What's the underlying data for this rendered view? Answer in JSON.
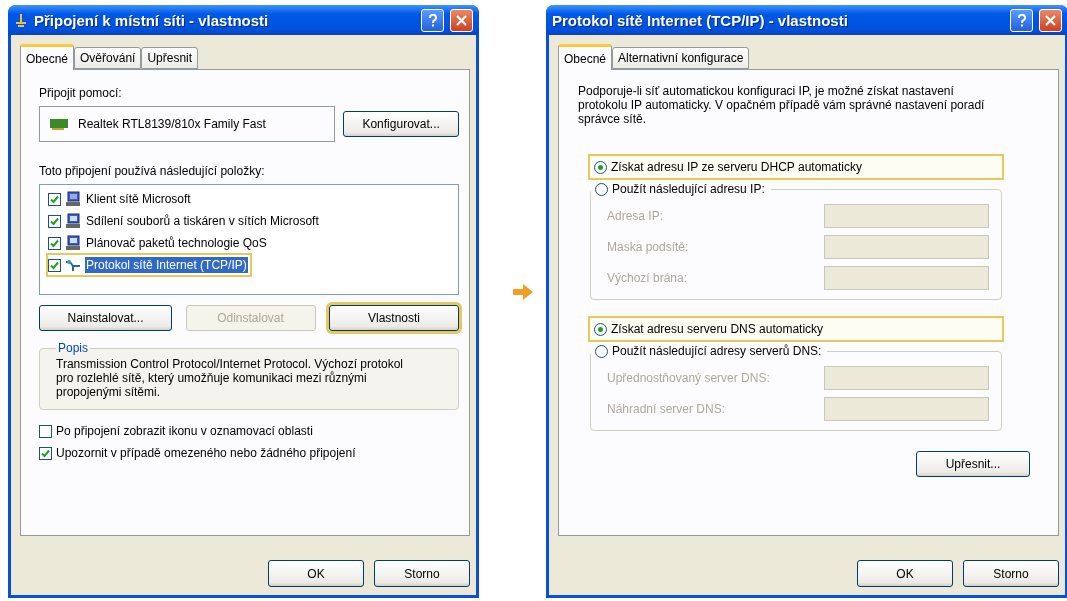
{
  "left_dialog": {
    "title": "Připojení k místní síti - vlastnosti",
    "tabs": [
      {
        "label": "Obecné",
        "selected": true
      },
      {
        "label": "Ověřování",
        "selected": false
      },
      {
        "label": "Upřesnit",
        "selected": false
      }
    ],
    "connect_label": "Připojit pomocí:",
    "adapter": "Realtek RTL8139/810x Family Fast",
    "configure_button": "Konfigurovat...",
    "items_label": "Toto připojení používá následující položky:",
    "items": [
      {
        "kind": "client",
        "label": "Klient sítě Microsoft",
        "checked": true,
        "selected": false,
        "highlighted": false
      },
      {
        "kind": "service",
        "label": "Sdílení souborů a tiskáren v sítích Microsoft",
        "checked": true,
        "selected": false,
        "highlighted": false
      },
      {
        "kind": "service",
        "label": "Plánovač paketů technologie QoS",
        "checked": true,
        "selected": false,
        "highlighted": false
      },
      {
        "kind": "protocol",
        "label": "Protokol sítě Internet (TCP/IP)",
        "checked": true,
        "selected": true,
        "highlighted": true
      }
    ],
    "buttons": [
      {
        "label": "Nainstalovat...",
        "disabled": false,
        "highlighted": false
      },
      {
        "label": "Odinstalovat",
        "disabled": true,
        "highlighted": false
      },
      {
        "label": "Vlastnosti",
        "disabled": false,
        "highlighted": true
      }
    ],
    "description": {
      "legend": "Popis",
      "text": "Transmission Control Protocol/Internet Protocol. Výchozí protokol pro rozlehlé sítě, který umožňuje komunikaci mezi různými propojenými sítěmi."
    },
    "options": [
      {
        "label": "Po připojení zobrazit ikonu v oznamovací oblasti",
        "checked": false
      },
      {
        "label": "Upozornit v případě omezeného nebo žádného připojení",
        "checked": true
      }
    ],
    "footer_buttons": [
      "OK",
      "Storno"
    ]
  },
  "right_dialog": {
    "title": "Protokol sítě Internet (TCP/IP) - vlastnosti",
    "tabs": [
      {
        "label": "Obecné",
        "selected": true
      },
      {
        "label": "Alternativní konfigurace",
        "selected": false
      }
    ],
    "intro": "Podporuje-li síť automatickou konfiguraci IP, je možné získat nastavení protokolu IP automaticky. V opačném případě vám správné nastavení poradí správce sítě.",
    "sections": [
      {
        "auto_option": {
          "label": "Získat adresu IP ze serveru DHCP automaticky",
          "selected": true,
          "highlighted": true
        },
        "manual_option": {
          "label": "Použít následující adresu IP:",
          "selected": false
        },
        "fields": [
          {
            "label": "Adresa IP:",
            "disabled": true
          },
          {
            "label": "Maska podsítě:",
            "disabled": true
          },
          {
            "label": "Výchozí brána:",
            "disabled": true
          }
        ]
      },
      {
        "auto_option": {
          "label": "Získat adresu serveru DNS automaticky",
          "selected": true,
          "highlighted": true
        },
        "manual_option": {
          "label": "Použít následující adresy serverů DNS:",
          "selected": false
        },
        "fields": [
          {
            "label": "Upřednostňovaný server DNS:",
            "disabled": true
          },
          {
            "label": "Náhradní server DNS:",
            "disabled": true
          }
        ]
      }
    ],
    "advanced_button": "Upřesnit...",
    "footer_buttons": [
      "OK",
      "Storno"
    ]
  }
}
